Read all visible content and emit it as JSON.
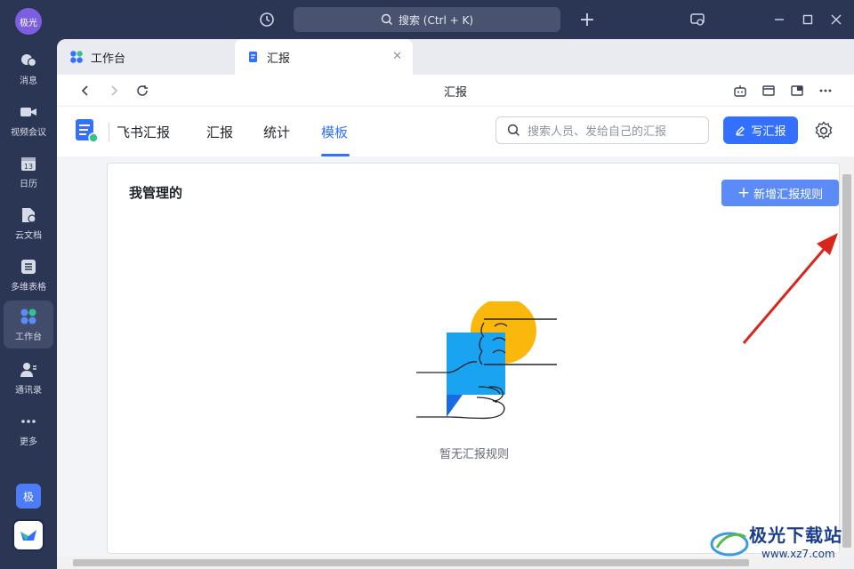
{
  "titlebar": {
    "avatar_text": "极光",
    "search_text": "搜索 (Ctrl + K)"
  },
  "sidebar": {
    "items": [
      {
        "label": "消息",
        "icon": "message-icon"
      },
      {
        "label": "视频会议",
        "icon": "video-icon"
      },
      {
        "label": "日历",
        "icon": "calendar-icon",
        "badge": "13"
      },
      {
        "label": "云文档",
        "icon": "doc-icon"
      },
      {
        "label": "多维表格",
        "icon": "table-icon"
      },
      {
        "label": "工作台",
        "icon": "workspace-icon",
        "active": true
      },
      {
        "label": "通讯录",
        "icon": "contacts-icon"
      },
      {
        "label": "更多",
        "icon": "more-icon"
      }
    ],
    "bottom_badge": "极"
  },
  "tabs": [
    {
      "label": "工作台",
      "active": false
    },
    {
      "label": "汇报",
      "active": true
    }
  ],
  "navbar": {
    "title": "汇报"
  },
  "app": {
    "name": "飞书汇报",
    "tabs": [
      {
        "label": "汇报",
        "active": false
      },
      {
        "label": "统计",
        "active": false
      },
      {
        "label": "模板",
        "active": true
      }
    ],
    "search_placeholder": "搜索人员、发给自己的汇报",
    "write_label": "写汇报"
  },
  "card": {
    "title": "我管理的",
    "add_label": "新增汇报规则",
    "empty_text": "暂无汇报规则"
  },
  "watermark": {
    "name": "极光下载站",
    "url": "www.xz7.com"
  },
  "colors": {
    "accent": "#3370ff",
    "sidebar_bg": "#2b3554",
    "add_button": "#5b8cf5",
    "annotation_arrow": "#d9261c"
  }
}
